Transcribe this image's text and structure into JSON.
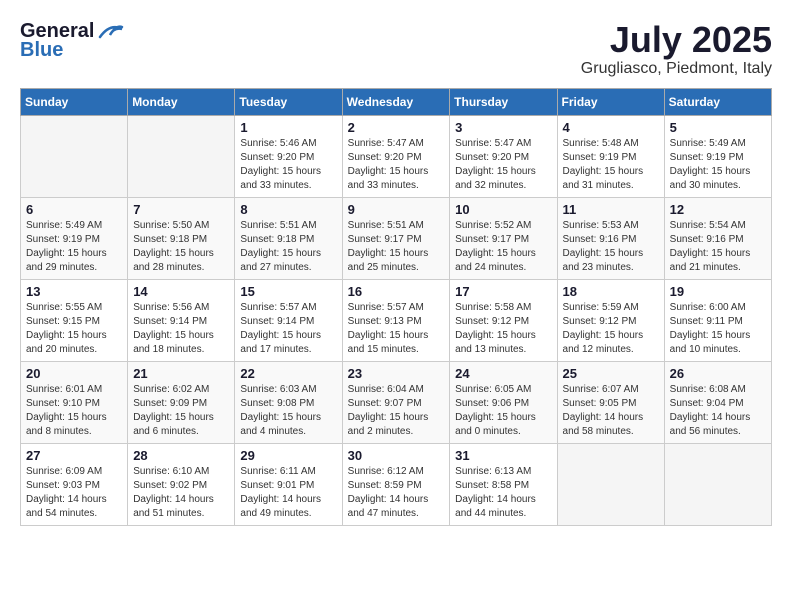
{
  "header": {
    "logo_general": "General",
    "logo_blue": "Blue",
    "month_title": "July 2025",
    "location": "Grugliasco, Piedmont, Italy"
  },
  "calendar": {
    "days_of_week": [
      "Sunday",
      "Monday",
      "Tuesday",
      "Wednesday",
      "Thursday",
      "Friday",
      "Saturday"
    ],
    "weeks": [
      [
        {
          "day": "",
          "info": ""
        },
        {
          "day": "",
          "info": ""
        },
        {
          "day": "1",
          "info": "Sunrise: 5:46 AM\nSunset: 9:20 PM\nDaylight: 15 hours and 33 minutes."
        },
        {
          "day": "2",
          "info": "Sunrise: 5:47 AM\nSunset: 9:20 PM\nDaylight: 15 hours and 33 minutes."
        },
        {
          "day": "3",
          "info": "Sunrise: 5:47 AM\nSunset: 9:20 PM\nDaylight: 15 hours and 32 minutes."
        },
        {
          "day": "4",
          "info": "Sunrise: 5:48 AM\nSunset: 9:19 PM\nDaylight: 15 hours and 31 minutes."
        },
        {
          "day": "5",
          "info": "Sunrise: 5:49 AM\nSunset: 9:19 PM\nDaylight: 15 hours and 30 minutes."
        }
      ],
      [
        {
          "day": "6",
          "info": "Sunrise: 5:49 AM\nSunset: 9:19 PM\nDaylight: 15 hours and 29 minutes."
        },
        {
          "day": "7",
          "info": "Sunrise: 5:50 AM\nSunset: 9:18 PM\nDaylight: 15 hours and 28 minutes."
        },
        {
          "day": "8",
          "info": "Sunrise: 5:51 AM\nSunset: 9:18 PM\nDaylight: 15 hours and 27 minutes."
        },
        {
          "day": "9",
          "info": "Sunrise: 5:51 AM\nSunset: 9:17 PM\nDaylight: 15 hours and 25 minutes."
        },
        {
          "day": "10",
          "info": "Sunrise: 5:52 AM\nSunset: 9:17 PM\nDaylight: 15 hours and 24 minutes."
        },
        {
          "day": "11",
          "info": "Sunrise: 5:53 AM\nSunset: 9:16 PM\nDaylight: 15 hours and 23 minutes."
        },
        {
          "day": "12",
          "info": "Sunrise: 5:54 AM\nSunset: 9:16 PM\nDaylight: 15 hours and 21 minutes."
        }
      ],
      [
        {
          "day": "13",
          "info": "Sunrise: 5:55 AM\nSunset: 9:15 PM\nDaylight: 15 hours and 20 minutes."
        },
        {
          "day": "14",
          "info": "Sunrise: 5:56 AM\nSunset: 9:14 PM\nDaylight: 15 hours and 18 minutes."
        },
        {
          "day": "15",
          "info": "Sunrise: 5:57 AM\nSunset: 9:14 PM\nDaylight: 15 hours and 17 minutes."
        },
        {
          "day": "16",
          "info": "Sunrise: 5:57 AM\nSunset: 9:13 PM\nDaylight: 15 hours and 15 minutes."
        },
        {
          "day": "17",
          "info": "Sunrise: 5:58 AM\nSunset: 9:12 PM\nDaylight: 15 hours and 13 minutes."
        },
        {
          "day": "18",
          "info": "Sunrise: 5:59 AM\nSunset: 9:12 PM\nDaylight: 15 hours and 12 minutes."
        },
        {
          "day": "19",
          "info": "Sunrise: 6:00 AM\nSunset: 9:11 PM\nDaylight: 15 hours and 10 minutes."
        }
      ],
      [
        {
          "day": "20",
          "info": "Sunrise: 6:01 AM\nSunset: 9:10 PM\nDaylight: 15 hours and 8 minutes."
        },
        {
          "day": "21",
          "info": "Sunrise: 6:02 AM\nSunset: 9:09 PM\nDaylight: 15 hours and 6 minutes."
        },
        {
          "day": "22",
          "info": "Sunrise: 6:03 AM\nSunset: 9:08 PM\nDaylight: 15 hours and 4 minutes."
        },
        {
          "day": "23",
          "info": "Sunrise: 6:04 AM\nSunset: 9:07 PM\nDaylight: 15 hours and 2 minutes."
        },
        {
          "day": "24",
          "info": "Sunrise: 6:05 AM\nSunset: 9:06 PM\nDaylight: 15 hours and 0 minutes."
        },
        {
          "day": "25",
          "info": "Sunrise: 6:07 AM\nSunset: 9:05 PM\nDaylight: 14 hours and 58 minutes."
        },
        {
          "day": "26",
          "info": "Sunrise: 6:08 AM\nSunset: 9:04 PM\nDaylight: 14 hours and 56 minutes."
        }
      ],
      [
        {
          "day": "27",
          "info": "Sunrise: 6:09 AM\nSunset: 9:03 PM\nDaylight: 14 hours and 54 minutes."
        },
        {
          "day": "28",
          "info": "Sunrise: 6:10 AM\nSunset: 9:02 PM\nDaylight: 14 hours and 51 minutes."
        },
        {
          "day": "29",
          "info": "Sunrise: 6:11 AM\nSunset: 9:01 PM\nDaylight: 14 hours and 49 minutes."
        },
        {
          "day": "30",
          "info": "Sunrise: 6:12 AM\nSunset: 8:59 PM\nDaylight: 14 hours and 47 minutes."
        },
        {
          "day": "31",
          "info": "Sunrise: 6:13 AM\nSunset: 8:58 PM\nDaylight: 14 hours and 44 minutes."
        },
        {
          "day": "",
          "info": ""
        },
        {
          "day": "",
          "info": ""
        }
      ]
    ]
  }
}
